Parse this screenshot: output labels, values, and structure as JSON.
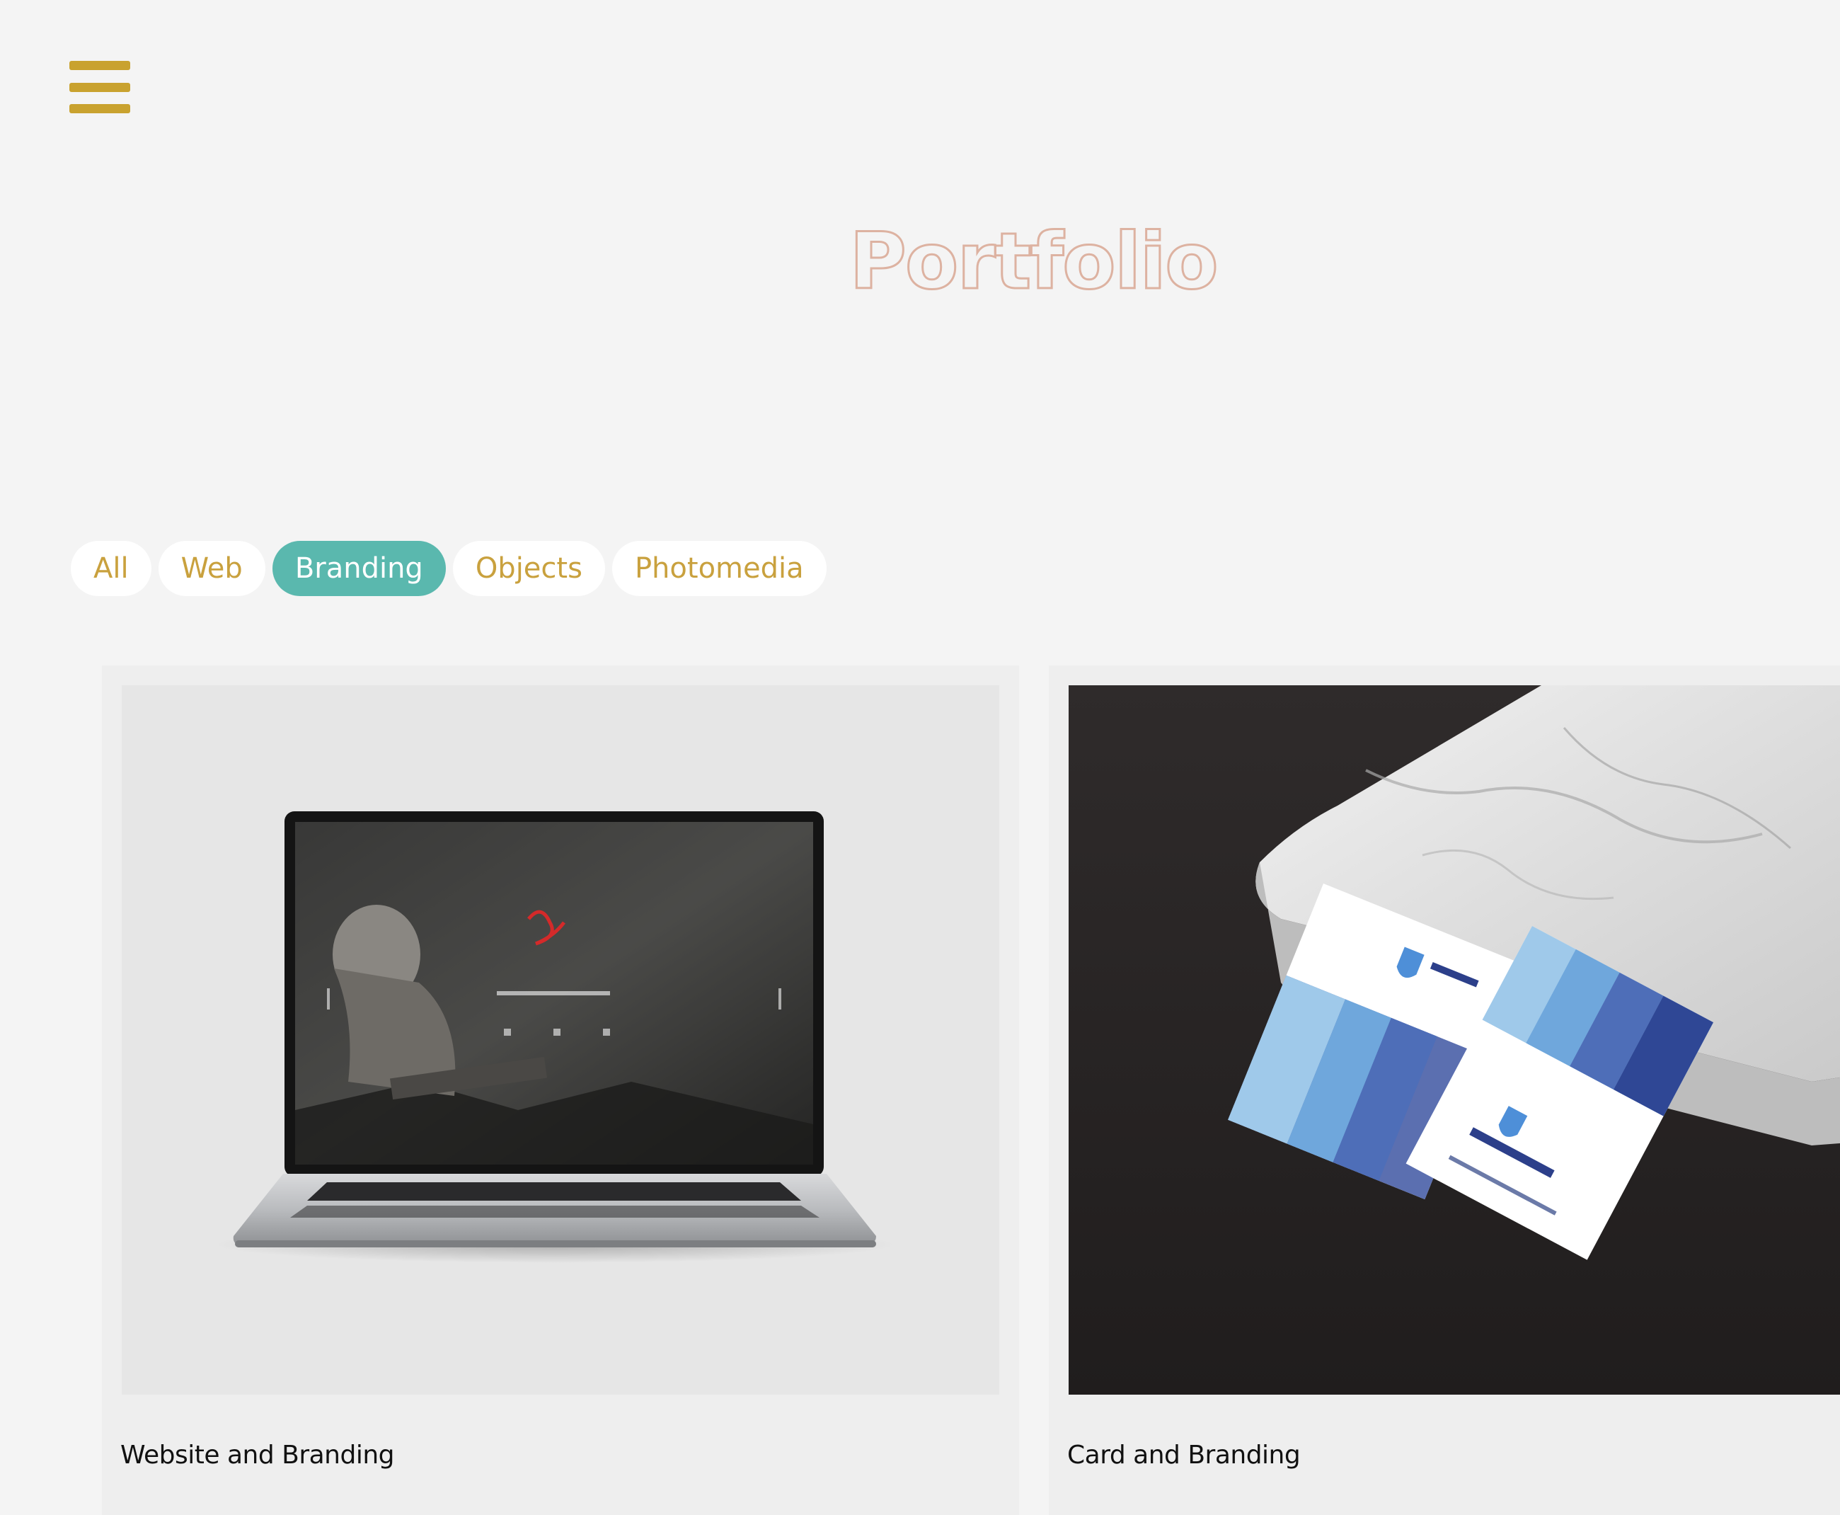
{
  "header": {
    "menu_icon": "hamburger-icon",
    "title": "Portfolio"
  },
  "filters": {
    "items": [
      "All",
      "Web",
      "Branding",
      "Objects",
      "Photomedia"
    ],
    "active": "Branding"
  },
  "portfolio": {
    "items": [
      {
        "caption": "Website and Branding",
        "image": "laptop-mockup"
      },
      {
        "caption": "Card and Branding",
        "image": "business-cards-on-marble"
      }
    ]
  },
  "colors": {
    "accent_gold": "#c9a22f",
    "active_teal": "#5ab8ae",
    "title_outline": "#ddb2a1",
    "background": "#f4f4f4"
  }
}
